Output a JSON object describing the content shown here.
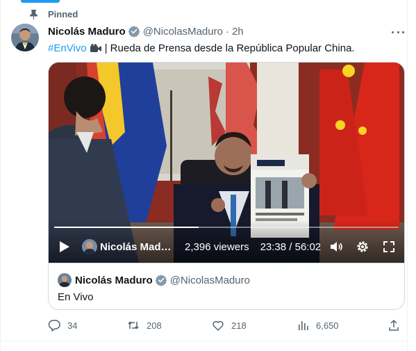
{
  "pinned_label": "Pinned",
  "author": {
    "name": "Nicolás Maduro",
    "handle": "@NicolasMaduro",
    "separator": "·",
    "time": "2h"
  },
  "tweet": {
    "hashtag": "#EnVivo",
    "text": "| Rueda de Prensa desde la República Popular China."
  },
  "video": {
    "live_author": "Nicolás Maduro",
    "viewers_count": "2,396",
    "viewers_label": "viewers",
    "time_display": "23:38 / 56:02",
    "progress_fraction": 0.42
  },
  "quote": {
    "name": "Nicolás Maduro",
    "handle": "@NicolasMaduro",
    "text": "En Vivo"
  },
  "actions": {
    "replies": "34",
    "reposts": "208",
    "likes": "218",
    "views": "6,650"
  },
  "colors": {
    "accent": "#1d9bf0",
    "muted": "#536471",
    "border": "#cfd9de"
  }
}
